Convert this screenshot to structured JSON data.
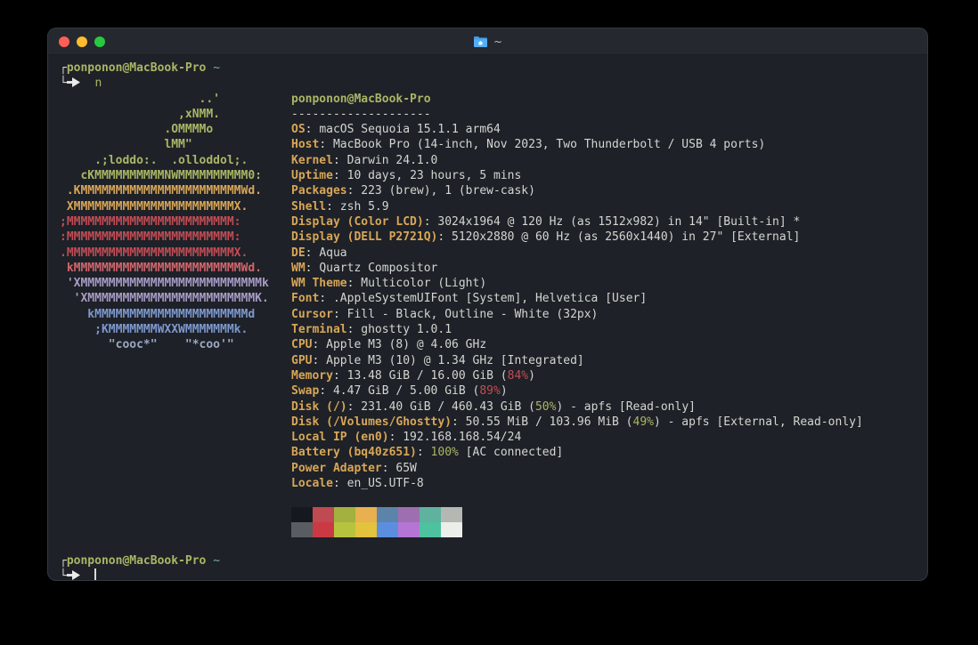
{
  "window": {
    "title": "~",
    "traffic_lights": {
      "close": "#ff5f57",
      "minimize": "#febc2e",
      "zoom": "#28c840"
    }
  },
  "colors": {
    "bg": "#1e2127",
    "titlebar": "#25282e",
    "fg": "#d3d6d0",
    "green": "#a9b665",
    "yellow": "#d8a657",
    "red": "#c24c55",
    "pink": "#d2666d",
    "lavender": "#a89cc6",
    "blue": "#7e99cf",
    "grayblue": "#9aa8c2",
    "cyan": "#7daea3"
  },
  "prompt": {
    "corner_top": "┌",
    "corner_bottom": "└",
    "user_host": "ponponon@MacBook-Pro",
    "path": "~",
    "command": "n"
  },
  "ascii_art": [
    [
      "                    ..'",
      "green"
    ],
    [
      "                 ,xNMM.",
      "green"
    ],
    [
      "               .OMMMMo",
      "green"
    ],
    [
      "               lMM\"",
      "green"
    ],
    [
      "     .;loddo:.  .olloddol;.",
      "green"
    ],
    [
      "   cKMMMMMMMMMMNWMMMMMMMMMM0:",
      "green"
    ],
    [
      " .KMMMMMMMMMMMMMMMMMMMMMMMWd.",
      "yellow"
    ],
    [
      " XMMMMMMMMMMMMMMMMMMMMMMMX.",
      "yellow"
    ],
    [
      ";MMMMMMMMMMMMMMMMMMMMMMMM:",
      "red"
    ],
    [
      ":MMMMMMMMMMMMMMMMMMMMMMMM:",
      "red"
    ],
    [
      ".MMMMMMMMMMMMMMMMMMMMMMMMX.",
      "red"
    ],
    [
      " kMMMMMMMMMMMMMMMMMMMMMMMMWd.",
      "pink"
    ],
    [
      " 'XMMMMMMMMMMMMMMMMMMMMMMMMMMk",
      "lavender"
    ],
    [
      "  'XMMMMMMMMMMMMMMMMMMMMMMMMK.",
      "lavender"
    ],
    [
      "    kMMMMMMMMMMMMMMMMMMMMMMd",
      "blue"
    ],
    [
      "     ;KMMMMMMMWXXWMMMMMMMk.",
      "blue"
    ],
    [
      "       \"cooc*\"    \"*coo'\"",
      "grayblue"
    ]
  ],
  "neofetch": {
    "title": "ponponon@MacBook-Pro",
    "separator": "--------------------",
    "info": [
      {
        "key": "OS",
        "segs": [
          [
            "macOS Sequoia 15.1.1 arm64",
            "fg"
          ]
        ]
      },
      {
        "key": "Host",
        "segs": [
          [
            "MacBook Pro (14-inch, Nov 2023, Two Thunderbolt / USB 4 ports)",
            "fg"
          ]
        ]
      },
      {
        "key": "Kernel",
        "segs": [
          [
            "Darwin 24.1.0",
            "fg"
          ]
        ]
      },
      {
        "key": "Uptime",
        "segs": [
          [
            "10 days, 23 hours, 5 mins",
            "fg"
          ]
        ]
      },
      {
        "key": "Packages",
        "segs": [
          [
            "223 (brew), 1 (brew-cask)",
            "fg"
          ]
        ]
      },
      {
        "key": "Shell",
        "segs": [
          [
            "zsh 5.9",
            "fg"
          ]
        ]
      },
      {
        "key": "Display (Color LCD)",
        "segs": [
          [
            "3024x1964 @ 120 Hz (as 1512x982) in 14\" [Built-in] *",
            "fg"
          ]
        ]
      },
      {
        "key": "Display (DELL P2721Q)",
        "segs": [
          [
            "5120x2880 @ 60 Hz (as 2560x1440) in 27\" [External]",
            "fg"
          ]
        ]
      },
      {
        "key": "DE",
        "segs": [
          [
            "Aqua",
            "fg"
          ]
        ]
      },
      {
        "key": "WM",
        "segs": [
          [
            "Quartz Compositor",
            "fg"
          ]
        ]
      },
      {
        "key": "WM Theme",
        "segs": [
          [
            "Multicolor (Light)",
            "fg"
          ]
        ]
      },
      {
        "key": "Font",
        "segs": [
          [
            ".AppleSystemUIFont [System], Helvetica [User]",
            "fg"
          ]
        ]
      },
      {
        "key": "Cursor",
        "segs": [
          [
            "Fill - Black, Outline - White (32px)",
            "fg"
          ]
        ]
      },
      {
        "key": "Terminal",
        "segs": [
          [
            "ghostty 1.0.1",
            "fg"
          ]
        ]
      },
      {
        "key": "CPU",
        "segs": [
          [
            "Apple M3 (8) @ 4.06 GHz",
            "fg"
          ]
        ]
      },
      {
        "key": "GPU",
        "segs": [
          [
            "Apple M3 (10) @ 1.34 GHz [Integrated]",
            "fg"
          ]
        ]
      },
      {
        "key": "Memory",
        "segs": [
          [
            "13.48 GiB / 16.00 GiB (",
            "fg"
          ],
          [
            "84%",
            "red"
          ],
          [
            ")",
            "fg"
          ]
        ]
      },
      {
        "key": "Swap",
        "segs": [
          [
            "4.47 GiB / 5.00 GiB (",
            "fg"
          ],
          [
            "89%",
            "red"
          ],
          [
            ")",
            "fg"
          ]
        ]
      },
      {
        "key": "Disk (/)",
        "segs": [
          [
            "231.40 GiB / 460.43 GiB (",
            "fg"
          ],
          [
            "50%",
            "green"
          ],
          [
            ") - apfs [Read-only]",
            "fg"
          ]
        ]
      },
      {
        "key": "Disk (/Volumes/Ghostty)",
        "segs": [
          [
            "50.55 MiB / 103.96 MiB (",
            "fg"
          ],
          [
            "49%",
            "green"
          ],
          [
            ") - apfs [External, Read-only]",
            "fg"
          ]
        ]
      },
      {
        "key": "Local IP (en0)",
        "segs": [
          [
            "192.168.168.54/24",
            "fg"
          ]
        ]
      },
      {
        "key": "Battery (bq40z651)",
        "segs": [
          [
            "100%",
            "green"
          ],
          [
            " [AC connected]",
            "fg"
          ]
        ]
      },
      {
        "key": "Power Adapter",
        "segs": [
          [
            "65W",
            "fg"
          ]
        ]
      },
      {
        "key": "Locale",
        "segs": [
          [
            "en_US.UTF-8",
            "fg"
          ]
        ]
      }
    ]
  },
  "palette": [
    [
      "#15181e",
      "#bf4a52",
      "#a2b140",
      "#e8b04f",
      "#5c83aa",
      "#9d6fb0",
      "#5fb39e",
      "#b3b8b3"
    ],
    [
      "#595d61",
      "#cb3a44",
      "#b6c33e",
      "#e3c23c",
      "#5c8ee0",
      "#b575d4",
      "#4ec19f",
      "#eceeea"
    ]
  ]
}
